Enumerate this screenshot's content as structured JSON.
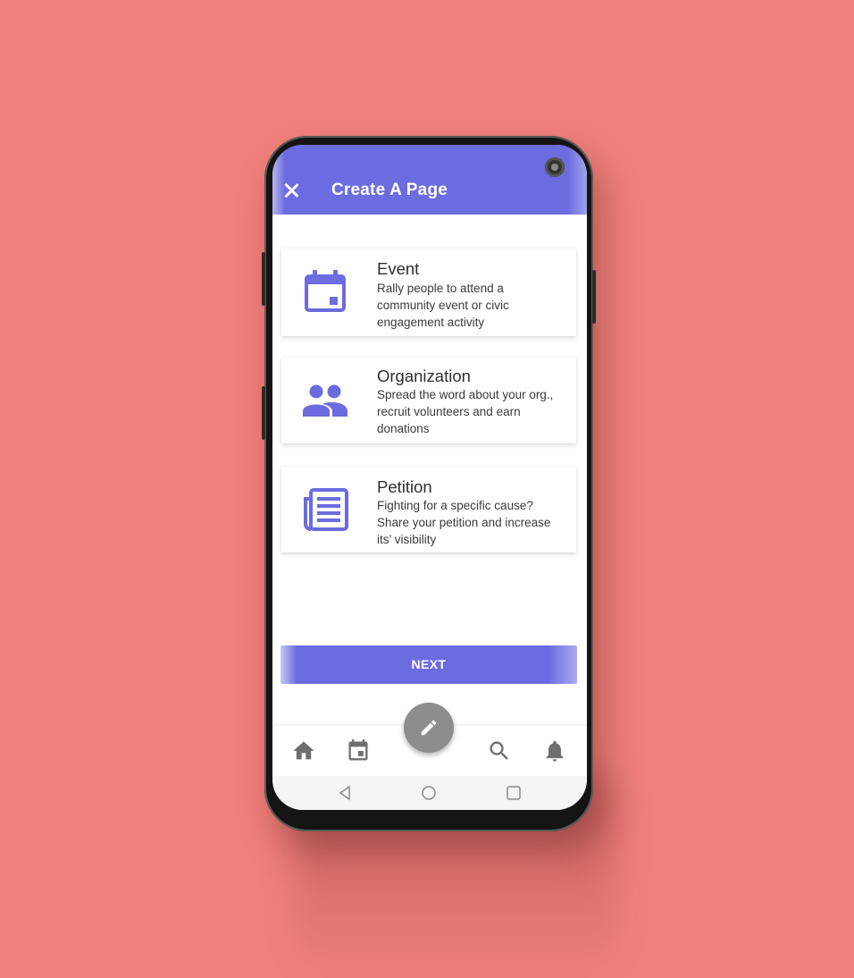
{
  "app": {
    "title": "Create A Page"
  },
  "options": [
    {
      "title": "Event",
      "description": "Rally people to attend a community event or civic engagement activity",
      "icon": "calendar-icon"
    },
    {
      "title": "Organization",
      "description": "Spread the word about your org., recruit volunteers and earn donations",
      "icon": "people-icon"
    },
    {
      "title": "Petition",
      "description": "Fighting for a specific cause? Share your petition and increase its’ visibility",
      "icon": "newspaper-icon"
    }
  ],
  "actions": {
    "next_label": "NEXT"
  },
  "bottom_nav": {
    "items": [
      "home-icon",
      "calendar-icon",
      "search-icon",
      "bell-icon"
    ],
    "fab_icon": "pencil-icon"
  },
  "system_nav": [
    "back-icon",
    "home-circle-icon",
    "recents-icon"
  ],
  "colors": {
    "background": "#ef7f7a",
    "accent": "#6c6be0",
    "fab": "#8d8d8d",
    "nav_icon": "#6e6e6e"
  }
}
